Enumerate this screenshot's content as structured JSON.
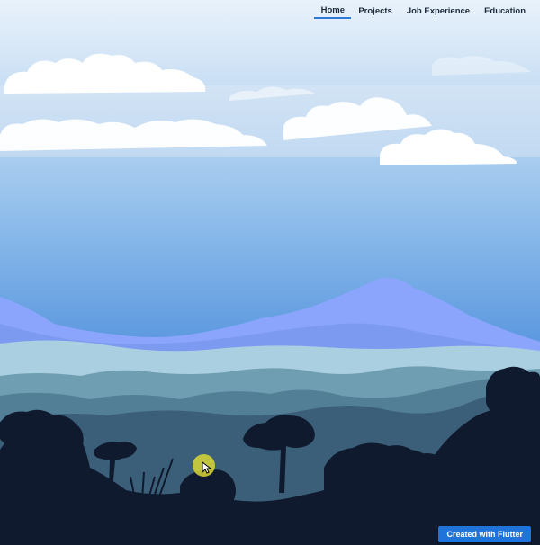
{
  "nav": {
    "tabs": [
      {
        "label": "Home",
        "active": true
      },
      {
        "label": "Projects",
        "active": false
      },
      {
        "label": "Job Experience",
        "active": false
      },
      {
        "label": "Education",
        "active": false
      }
    ]
  },
  "footer": {
    "flutter_label": "Created with Flutter"
  },
  "colors": {
    "accent": "#2c7ad6",
    "button": "#1f73d9",
    "sky_top": "#e8f1fb",
    "sky_mid": "#7fb3ea",
    "mountain_far": "#8ba6ff",
    "foreground": "#0f1a2e",
    "cursor_highlight": "#dad734"
  }
}
